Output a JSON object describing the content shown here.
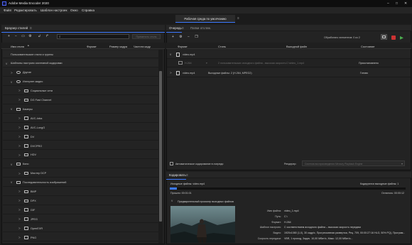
{
  "app": {
    "title": "Adobe Media Encoder 2020"
  },
  "menu": [
    "Файл",
    "Редактировать",
    "Шаблон настроек",
    "Окно",
    "Справка"
  ],
  "workspace_tab": "Рабочая среда по умолчанию",
  "preset_browser": {
    "title": "Браузер стилей",
    "search_placeholder": "",
    "apply_button": "Применить стиль",
    "columns": [
      "Имя стиля",
      "Формат",
      "Размер кадра",
      "Частота кадр"
    ],
    "rows": [
      {
        "label": "Пользовательские стили и группы",
        "depth": 0,
        "chevron": "",
        "icon": "none"
      },
      {
        "label": "Шаблоны настроек системной кодировки",
        "depth": 0,
        "chevron": "v",
        "icon": "none"
      },
      {
        "label": "Другие",
        "depth": 1,
        "chevron": ">",
        "icon": "globe"
      },
      {
        "label": "Интернет-видео",
        "depth": 1,
        "chevron": "v",
        "icon": "globe"
      },
      {
        "label": "Социальные сети",
        "depth": 2,
        "chevron": ">",
        "icon": "folder"
      },
      {
        "label": "DG Fast Channel",
        "depth": 2,
        "chevron": ">",
        "icon": "folder"
      },
      {
        "label": "Камеры",
        "depth": 1,
        "chevron": "v",
        "icon": "camera"
      },
      {
        "label": "AVC-Intra",
        "depth": 2,
        "chevron": ">",
        "icon": "folder"
      },
      {
        "label": "AVC-LongG",
        "depth": 2,
        "chevron": ">",
        "icon": "folder"
      },
      {
        "label": "DV",
        "depth": 2,
        "chevron": ">",
        "icon": "folder"
      },
      {
        "label": "DVCPRO",
        "depth": 2,
        "chevron": ">",
        "icon": "folder"
      },
      {
        "label": "HDV",
        "depth": 2,
        "chevron": ">",
        "icon": "folder"
      },
      {
        "label": "Кино",
        "depth": 1,
        "chevron": "v",
        "icon": "film"
      },
      {
        "label": "Мастер DCP",
        "depth": 2,
        "chevron": ">",
        "icon": "folder"
      },
      {
        "label": "Последовательность изображений",
        "depth": 1,
        "chevron": "v",
        "icon": "image"
      },
      {
        "label": "BMP",
        "depth": 2,
        "chevron": ">",
        "icon": "folder"
      },
      {
        "label": "DPX",
        "depth": 2,
        "chevron": ">",
        "icon": "folder"
      },
      {
        "label": "GIF",
        "depth": 2,
        "chevron": ">",
        "icon": "folder"
      },
      {
        "label": "JPEG",
        "depth": 2,
        "chevron": ">",
        "icon": "folder"
      },
      {
        "label": "OpenEXR",
        "depth": 2,
        "chevron": ">",
        "icon": "folder"
      },
      {
        "label": "PNG",
        "depth": 2,
        "chevron": ">",
        "icon": "folder"
      }
    ]
  },
  "queue": {
    "tab_queue": "Очередь",
    "tab_watch": "Папки отслеж.",
    "status_count": "Обработано элементов: 0 из 2",
    "columns": [
      "Формат",
      "Стиль",
      "Выходной файл",
      "Состояние"
    ],
    "items": [
      {
        "name": "video.mp4",
        "child": {
          "format": "H.264",
          "preset": "2 пользовательских исходного файла - высокая скорость",
          "output": "C:\\video_1.mp4",
          "status": "Приостановлено"
        }
      },
      {
        "name": "video.mp4",
        "child": {
          "format": "Выходные файлы: 2 (H.264, MPEG2)",
          "preset": "",
          "output": "",
          "status": "Готово"
        }
      }
    ],
    "auto_encode_label": "Автоматическое кодирование в очереди",
    "renderer_label": "Рендерер:",
    "renderer_value": "Система воспроизведения Mercury Playback Engine"
  },
  "encoding": {
    "title": "Кодировать",
    "source_label": "Исходные файлы: video.mp4",
    "encoding_count": "Кодируются выходные файлы: 1",
    "progress": 0.03,
    "elapsed": "Прошло: 00:01:01",
    "remaining": "Осталось: 00:00:12",
    "preview_section": "Предварительный просмотр выходных файлов",
    "meta": [
      {
        "key": "Имя файла:",
        "value": "video_1.mp4"
      },
      {
        "key": "Путь:",
        "value": "C:\\"
      },
      {
        "key": "Формат:",
        "value": "H.264"
      },
      {
        "key": "Шаблон настроек:",
        "value": "С соответствием исходного файла – высокая скорость передачи"
      },
      {
        "key": "Видео:",
        "value": "1920x1080 (1,0), 30 кадр/с, Прогрессивная развертка, Рец. 709, 00:00:27:16 HLG, 50% PQ), Програм..."
      },
      {
        "key": "Скорость передачи:",
        "value": "VBR, 1 проход, Задач. 10,00 Мбит/с, Макс: 12,00 Мбит/с..."
      }
    ]
  }
}
